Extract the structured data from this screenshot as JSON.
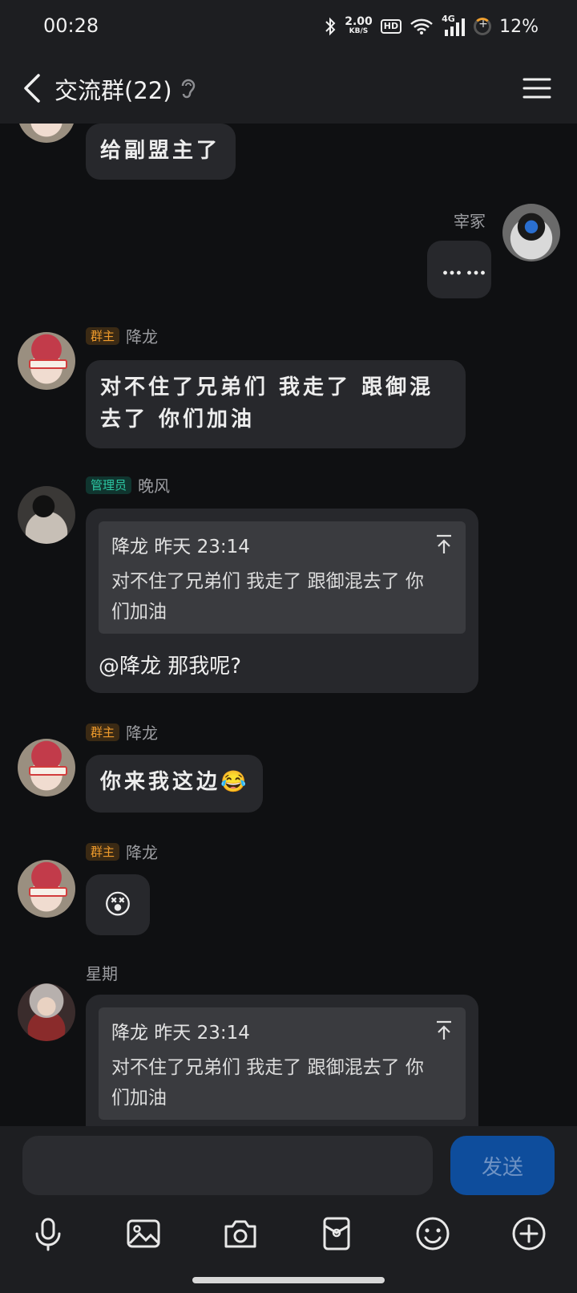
{
  "status_bar": {
    "time": "00:28",
    "net_speed": "2.00",
    "net_unit": "KB/S",
    "hd": "HD",
    "network": "4G",
    "battery": "12%"
  },
  "header": {
    "title": "交流群(22)"
  },
  "messages": {
    "m1_text": "给副盟主了",
    "m2_name": "宰冢",
    "m2_text": "……",
    "m3_badge": "群主",
    "m3_name": "降龙",
    "m3_text": "对不住了兄弟们  我走了 跟御混去了  你们加油",
    "m4_badge": "管理员",
    "m4_name": "晚风",
    "m4_quote_head": "降龙 昨天 23:14",
    "m4_quote_text": "对不住了兄弟们 我走了 跟御混去了 你们加油",
    "m4_reply": "@降龙 那我呢?",
    "m5_badge": "群主",
    "m5_name": "降龙",
    "m5_text": "你来我这边",
    "m5_emoji": "😂",
    "m6_badge": "群主",
    "m6_name": "降龙",
    "m6_emoji": "😵",
    "m7_name": "星期",
    "m7_quote_head": "降龙 昨天 23:14",
    "m7_quote_text": "对不住了兄弟们 我走了 跟御混去了 你们加油"
  },
  "input_bar": {
    "send_label": "发送",
    "tools": [
      "mic-icon",
      "image-icon",
      "camera-icon",
      "red-packet-icon",
      "emoji-icon",
      "plus-icon"
    ]
  },
  "colors": {
    "background": "#0f1012",
    "bar": "#1d1e21",
    "bubble": "#27282c",
    "owner_badge": "#ef9b2c",
    "admin_badge": "#2cc8a3",
    "send_button": "#0e4d9c"
  }
}
